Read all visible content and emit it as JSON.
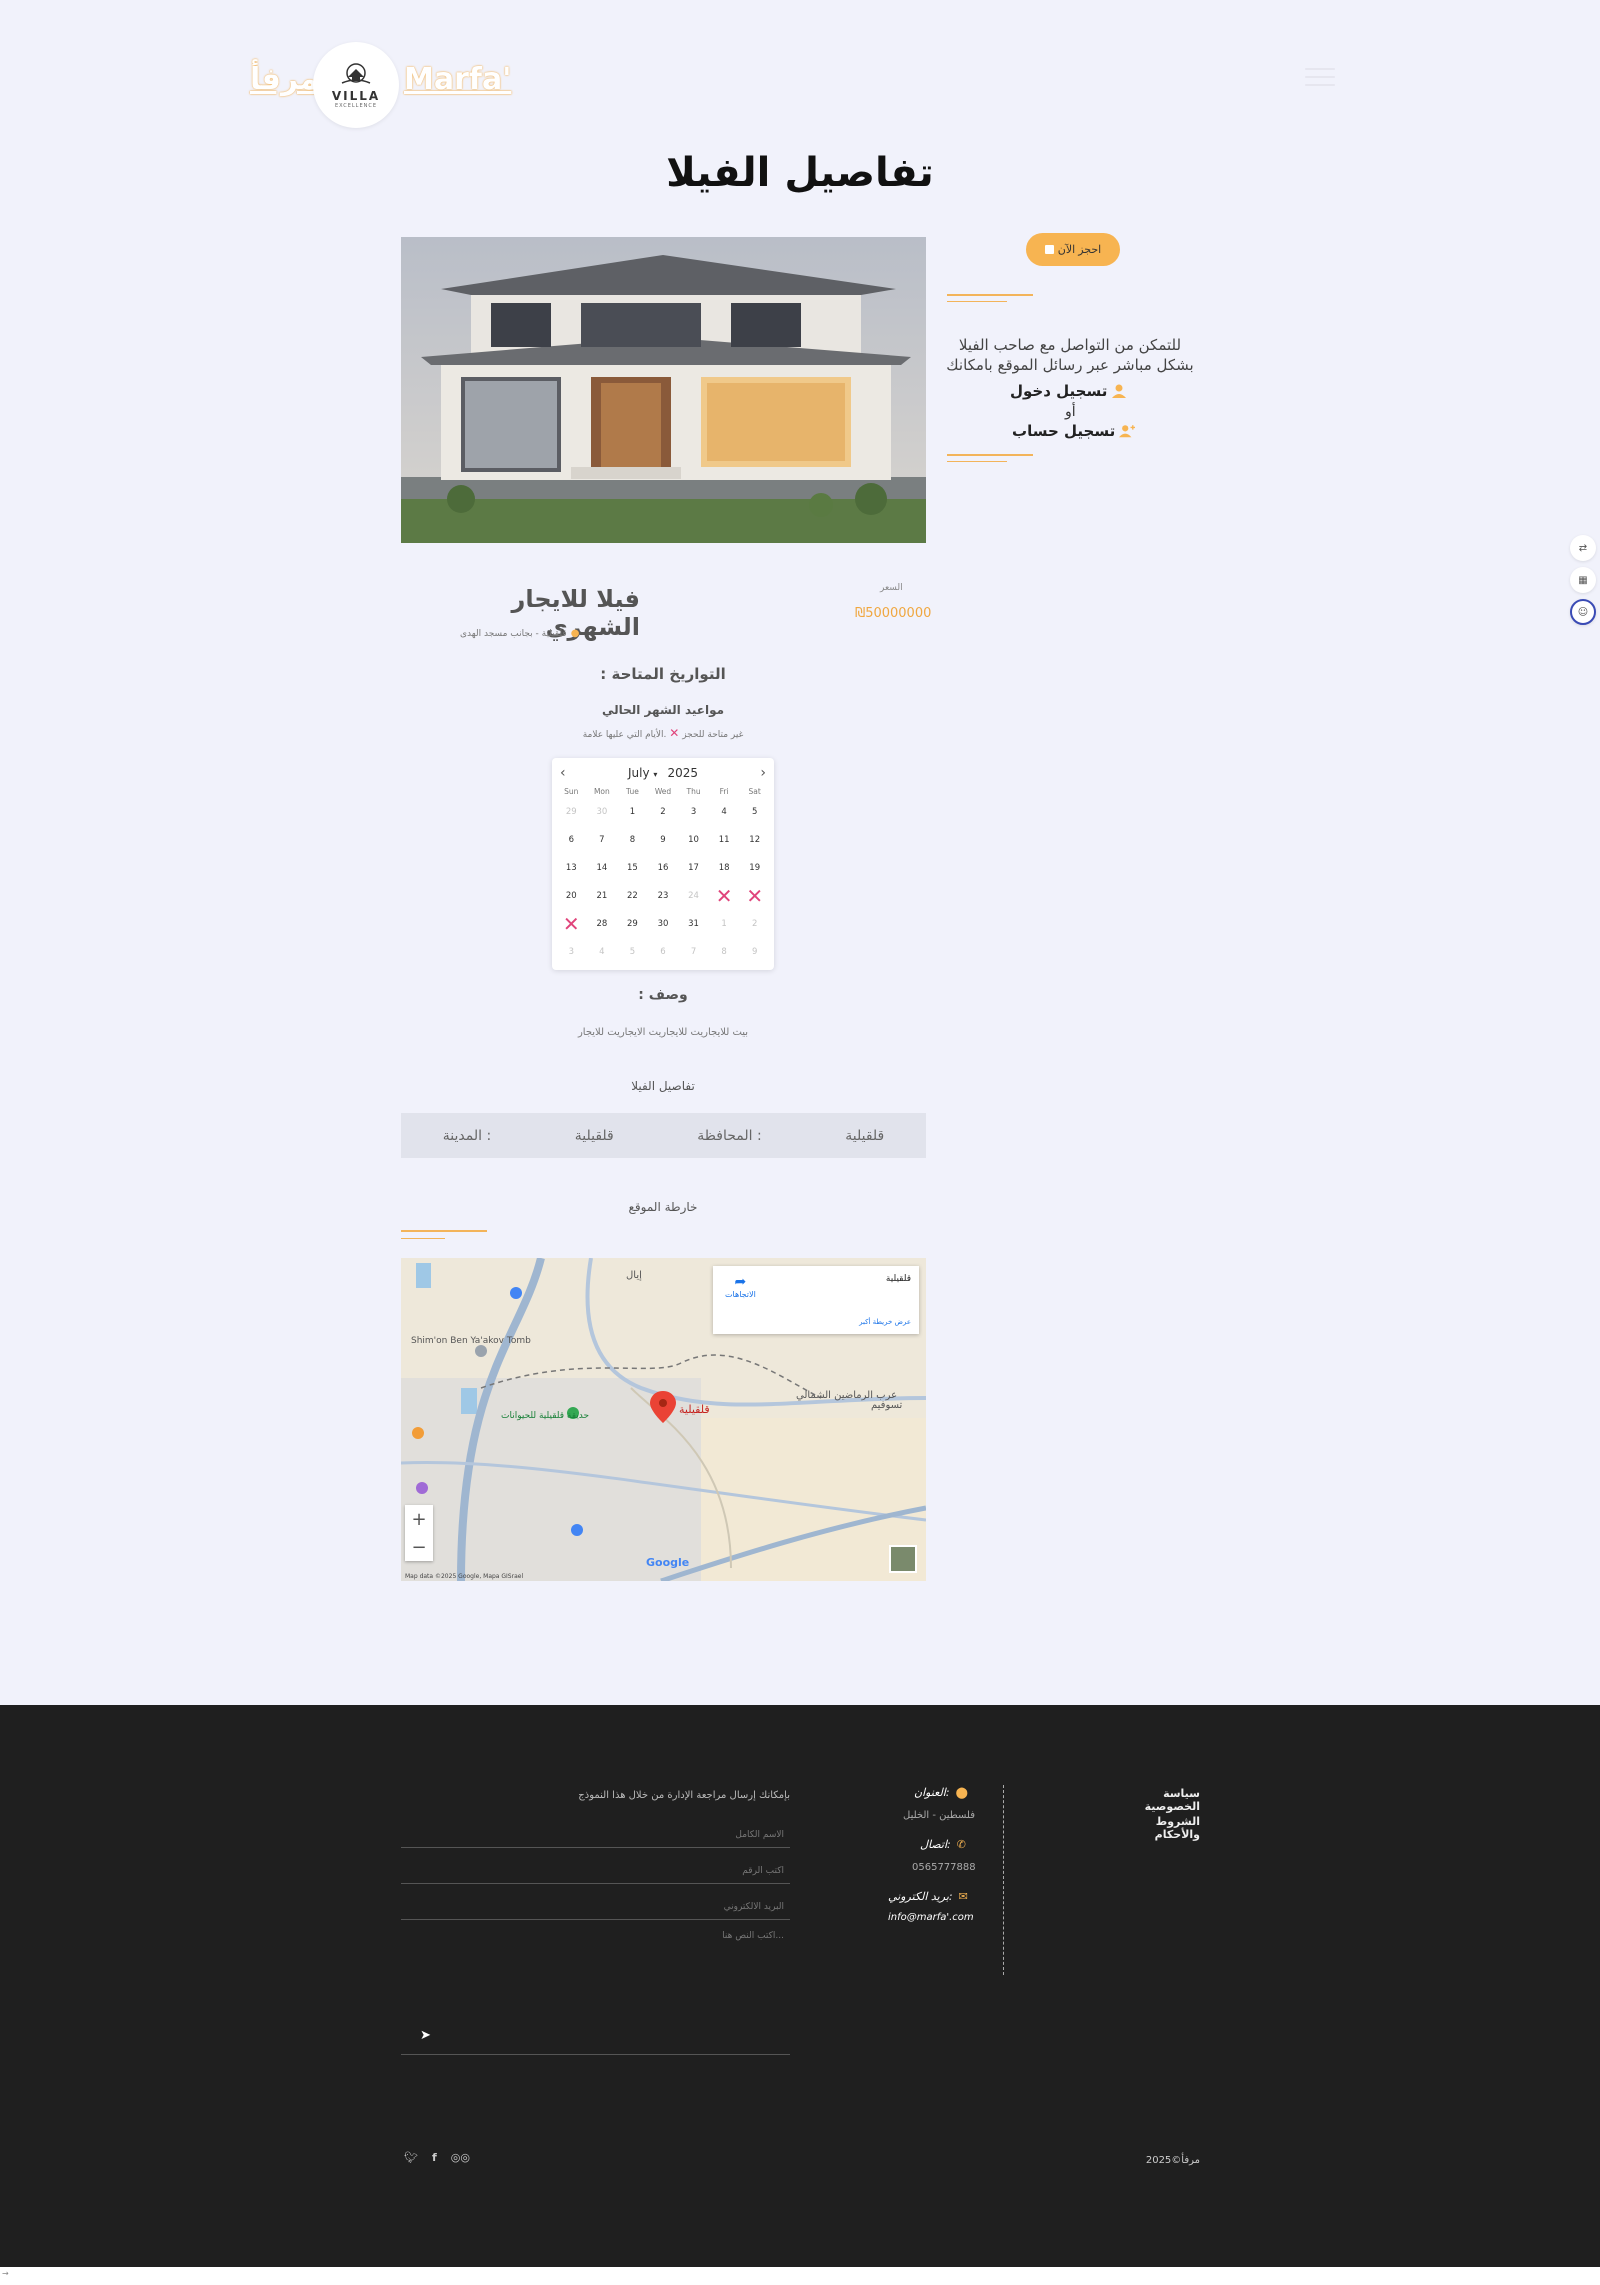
{
  "header": {
    "brand_ar": "مرفأ",
    "brand_en": "Marfa'",
    "logo_word": "VILLA",
    "logo_sub": "EXCELLENCE"
  },
  "page_title": "تفاصيل الفيلا",
  "sidebar": {
    "book_button": "احجز الآن",
    "contact_text": "للتمكن من التواصل مع صاحب الفيلا بشكل مباشر عبر رسائل الموقع بامكانك",
    "login_link": "تسجيل دخول",
    "or_text": "أو",
    "signup_link": "تسجيل حساب"
  },
  "villa": {
    "name": "فيلا للايجار الشهري",
    "location": "قلقيلية - بجانب مسجد الهدى",
    "price_label": "السعر",
    "price": "₪50000000"
  },
  "availability": {
    "title": ": التواريخ المتاحة",
    "month_title": "مواعيد الشهر الحالي",
    "booked_note_before": ".الأيام التي عليها علامة",
    "booked_note_after": "غير متاحة للحجز"
  },
  "calendar": {
    "month": "July",
    "year": "2025",
    "weekdays": [
      "Sun",
      "Mon",
      "Tue",
      "Wed",
      "Thu",
      "Fri",
      "Sat"
    ],
    "weeks": [
      [
        {
          "d": "29",
          "s": "muted"
        },
        {
          "d": "30",
          "s": "muted"
        },
        {
          "d": "1"
        },
        {
          "d": "2"
        },
        {
          "d": "3"
        },
        {
          "d": "4"
        },
        {
          "d": "5"
        }
      ],
      [
        {
          "d": "6"
        },
        {
          "d": "7"
        },
        {
          "d": "8"
        },
        {
          "d": "9"
        },
        {
          "d": "10"
        },
        {
          "d": "11"
        },
        {
          "d": "12"
        }
      ],
      [
        {
          "d": "13"
        },
        {
          "d": "14"
        },
        {
          "d": "15"
        },
        {
          "d": "16"
        },
        {
          "d": "17"
        },
        {
          "d": "18"
        },
        {
          "d": "19"
        }
      ],
      [
        {
          "d": "20"
        },
        {
          "d": "21"
        },
        {
          "d": "22"
        },
        {
          "d": "23"
        },
        {
          "d": "24",
          "s": "muted"
        },
        {
          "d": "25",
          "s": "booked"
        },
        {
          "d": "26",
          "s": "booked"
        }
      ],
      [
        {
          "d": "27",
          "s": "booked"
        },
        {
          "d": "28"
        },
        {
          "d": "29"
        },
        {
          "d": "30"
        },
        {
          "d": "31"
        },
        {
          "d": "1",
          "s": "muted"
        },
        {
          "d": "2",
          "s": "muted"
        }
      ],
      [
        {
          "d": "3",
          "s": "muted"
        },
        {
          "d": "4",
          "s": "muted"
        },
        {
          "d": "5",
          "s": "muted"
        },
        {
          "d": "6",
          "s": "muted"
        },
        {
          "d": "7",
          "s": "muted"
        },
        {
          "d": "8",
          "s": "muted"
        },
        {
          "d": "9",
          "s": "muted"
        }
      ]
    ]
  },
  "description": {
    "title": ": وصف",
    "text": "بيت للايجاريت للايجاريت الايجاريت للايجار"
  },
  "details": {
    "title": "تفاصيل الفيلا",
    "governorate_value": "قلقيلية",
    "governorate_label": ": المحافظة",
    "city_value": "قلقيلية",
    "city_label": ": المدينة"
  },
  "map": {
    "title": "خارطة الموقع",
    "card_title": "قلقيلية",
    "directions": "الاتجاهات",
    "larger_map": "عرض خريطة أكبر",
    "marker_label": "قلقيلية",
    "place_1": "إيال",
    "place_2": "عرب الرماضين الشمالي",
    "place_3": "تسوفيم",
    "place_4": "حديقة قلقيلية للحيوانات",
    "place_5": "Shim'on Ben Ya'akov Tomb",
    "zoom_in": "+",
    "zoom_out": "−",
    "attribution": "Map data ©2025 Google, Mapa GISrael",
    "google": "Google"
  },
  "footer": {
    "privacy": "سياسة الخصوصية",
    "terms": "الشروط والأحكام",
    "address_label": "العنوان:",
    "address_value": "فلسطين - الخليل",
    "phone_label": "اتصال:",
    "phone_value": "0565777888",
    "email_label": "بريد الكتروني:",
    "email_value": "info@marfa'.com",
    "form_note": "بإمكانك إرسال مراجعة الإدارة من خلال هذا النموذج",
    "name_placeholder": "الاسم الكامل",
    "phone_placeholder": "اكتب الرقم",
    "email_placeholder": "البريد الالكتروني",
    "message_placeholder": "اكتب النص هنا...",
    "copyright": "مرفأ©2025"
  },
  "colors": {
    "accent": "#f7b451",
    "booked": "#e0447b",
    "footer_bg": "#1f1f1f",
    "page_bg": "#f1f2fb"
  }
}
